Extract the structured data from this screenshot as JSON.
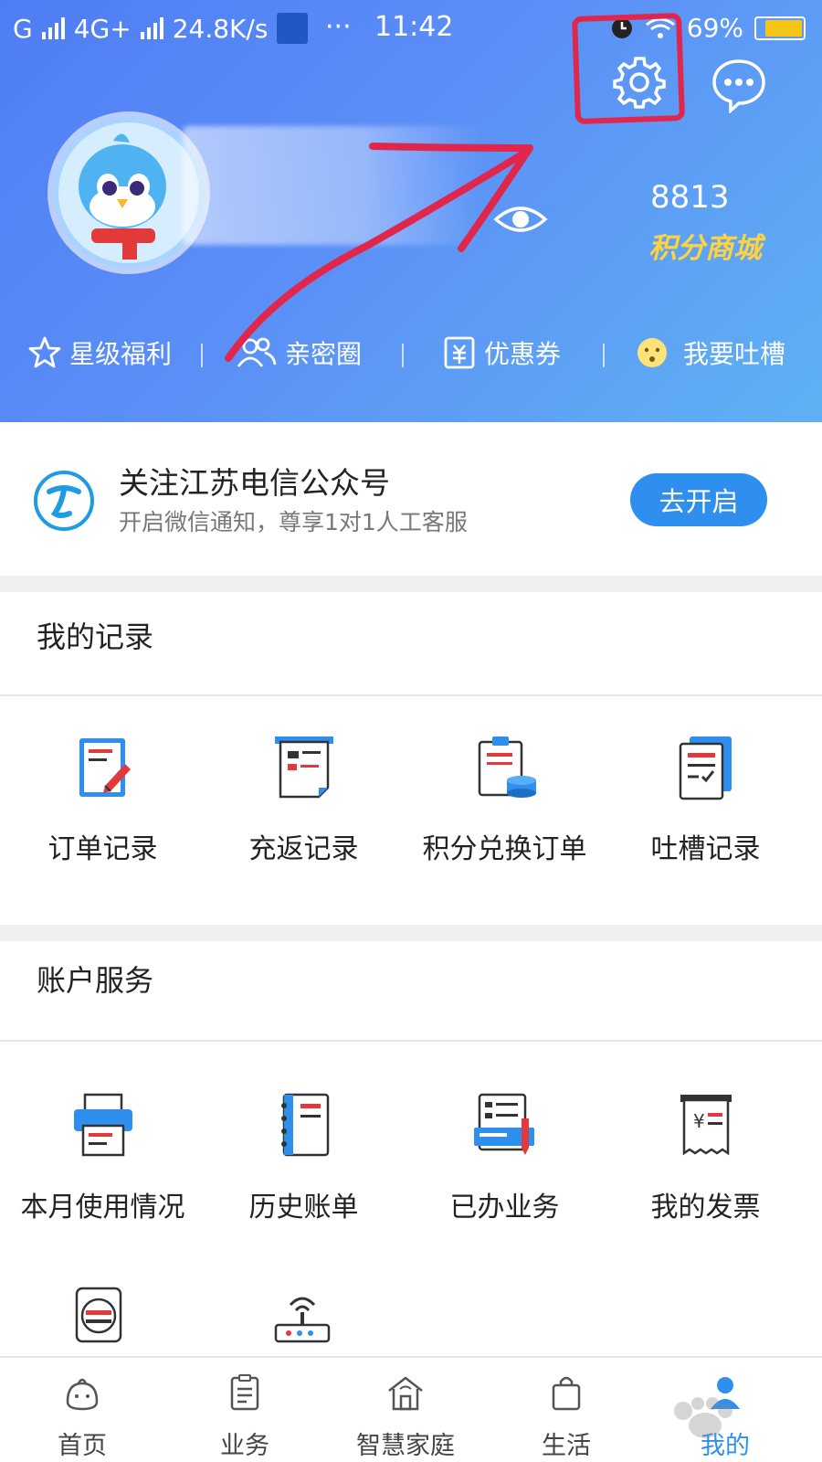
{
  "status_bar": {
    "network1": "G",
    "network2": "4G+",
    "speed": "24.8K/s",
    "dots": "···",
    "time": "11:42",
    "battery": "69%"
  },
  "header": {
    "points_value": "8813",
    "points_mall": "积分商城",
    "quick_links": [
      {
        "label": "星级福利",
        "icon": "star-icon"
      },
      {
        "label": "亲密圈",
        "icon": "people-icon"
      },
      {
        "label": "优惠券",
        "icon": "coupon-icon"
      },
      {
        "label": "我要吐槽",
        "icon": "face-icon"
      }
    ]
  },
  "banner": {
    "title": "关注江苏电信公众号",
    "subtitle": "开启微信通知，尊享1对1人工客服",
    "button": "去开启"
  },
  "records": {
    "title": "我的记录",
    "items": [
      {
        "label": "订单记录",
        "icon": "order-record-icon"
      },
      {
        "label": "充返记录",
        "icon": "recharge-record-icon"
      },
      {
        "label": "积分兑换订单",
        "icon": "points-exchange-icon"
      },
      {
        "label": "吐槽记录",
        "icon": "complaint-record-icon"
      }
    ]
  },
  "account": {
    "title": "账户服务",
    "items": [
      {
        "label": "本月使用情况",
        "icon": "printer-icon"
      },
      {
        "label": "历史账单",
        "icon": "bill-book-icon"
      },
      {
        "label": "已办业务",
        "icon": "handled-business-icon"
      },
      {
        "label": "我的发票",
        "icon": "invoice-icon"
      }
    ]
  },
  "tabbar": {
    "tabs": [
      {
        "label": "首页",
        "icon": "home-mascot-icon"
      },
      {
        "label": "业务",
        "icon": "business-icon"
      },
      {
        "label": "智慧家庭",
        "icon": "smart-home-icon"
      },
      {
        "label": "生活",
        "icon": "shopping-bag-icon"
      },
      {
        "label": "我的",
        "icon": "profile-icon"
      }
    ],
    "active": "我的"
  },
  "colors": {
    "header_start": "#4f7df4",
    "header_end": "#5fb1f3",
    "accent": "#2f8fef",
    "points_mall": "#ffd23f",
    "annotation": "#e0264b"
  }
}
